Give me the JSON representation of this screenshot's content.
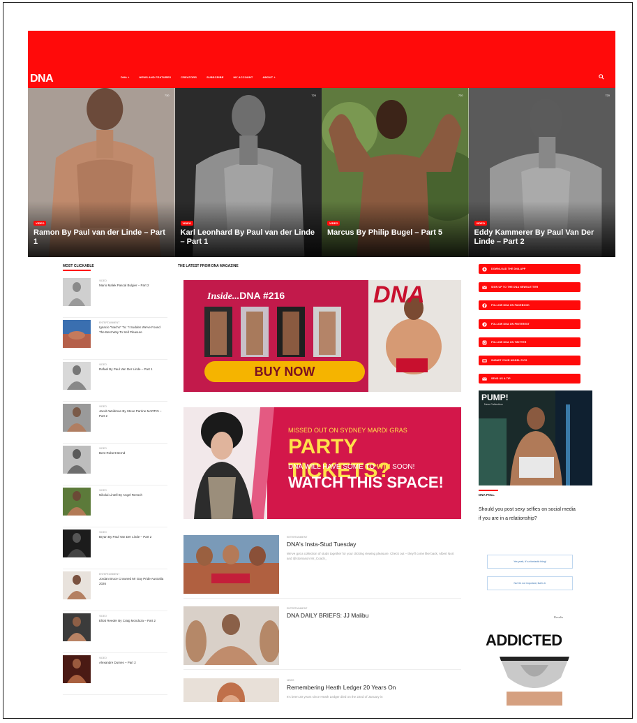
{
  "brand": {
    "logo": "DNA",
    "accent": "#ff0a0a"
  },
  "nav": [
    "DNA +",
    "NEWS AND FEATURES",
    "CREATORS",
    "SUBSCRIBE",
    "MY ACCOUNT",
    "ABOUT +"
  ],
  "hero": [
    {
      "tag": "VIDEO",
      "title": "Ramon By Paul van der Linde – Part 1",
      "views": "730"
    },
    {
      "tag": "VIDEO",
      "title": "Karl Leonhard By Paul van der Linde – Part 1",
      "views": "720"
    },
    {
      "tag": "VIDEO",
      "title": "Marcus By Philip Bugel – Part 5",
      "views": "720"
    },
    {
      "tag": "VIDEO",
      "title": "Eddy Kammerer By Paul Van Der Linde – Part 2",
      "views": "720"
    }
  ],
  "most_clickable": {
    "heading": "MOST CLICKABLE",
    "items": [
      {
        "kicker": "VIDEO",
        "title": "Mario Malek Pascal Bulgier – Part 2"
      },
      {
        "kicker": "ENTERTAINMENT",
        "title": "Ignacio \"Nacho\" Tu: \"I Sudden We've Found The Best Way To Sell Pleasure"
      },
      {
        "kicker": "VIDEO",
        "title": "Rafael By Paul Van Der Linde – Part 1"
      },
      {
        "kicker": "VIDEO",
        "title": "Jacob Weidman By Steve Parrine MARTIN – Part 2"
      },
      {
        "kicker": "VIDEO",
        "title": "Bent Robert Bernd"
      },
      {
        "kicker": "VIDEO",
        "title": "Nikolai Lintell By Angel Rensch"
      },
      {
        "kicker": "VIDEO",
        "title": "Bryan By Paul Van Der Linde – Part 2"
      },
      {
        "kicker": "ENTERTAINMENT",
        "title": "Jordan Bruce Crowned Mr Gay Pride Australia 2026"
      },
      {
        "kicker": "VIDEO",
        "title": "Eliott Reeder By Craig Mcndoza – Part 2"
      },
      {
        "kicker": "VIDEO",
        "title": "Alexandre Dumes – Part 2"
      }
    ]
  },
  "latest": {
    "heading": "THE LATEST FROM DNA MAGAZINE",
    "ad1": {
      "inside": "Inside...",
      "issue": "DNA #216",
      "cta": "BUY NOW",
      "cover_logo": "DNA"
    },
    "ad2": {
      "line1": "MISSED OUT ON SYDNEY MARDI GRAS",
      "line2": "PARTY TICKETS?",
      "line3a": "DNA WILL HAVE SOME TO ",
      "line3b": "WIN",
      "line3c": " SOON!",
      "line4": "WATCH THIS SPACE!"
    },
    "articles": [
      {
        "kicker": "ENTERTAINMENT",
        "title": "DNA's Insta-Stud Tuesday",
        "excerpt": "We've got a collection of studs together for your clicking viewing pleasure. Check out – they'll come like back, Albert Nort and @stomason Mr_Coach_"
      },
      {
        "kicker": "ENTERTAINMENT",
        "title": "DNA DAILY BRIEFS: JJ Malibu",
        "excerpt": ""
      },
      {
        "kicker": "NEWS",
        "title": "Remembering Heath Ledger 20 Years On",
        "excerpt": "It's been 20 years since Heath Ledger died on the 22nd of January in"
      }
    ]
  },
  "sidebar": {
    "buttons": [
      {
        "icon": "download-icon",
        "label": "DOWNLOAD THE DNA APP"
      },
      {
        "icon": "mail-icon",
        "label": "SIGN UP TO THE DNA NEWSLETTER"
      },
      {
        "icon": "facebook-icon",
        "label": "FOLLOW DNA ON FACEBOOK"
      },
      {
        "icon": "pinterest-icon",
        "label": "FOLLOW DNA ON PINTEREST"
      },
      {
        "icon": "instagram-icon",
        "label": "FOLLOW DNA ON TWITTER"
      },
      {
        "icon": "shop-icon",
        "label": "SUBMIT YOUR MODEL PICS"
      },
      {
        "icon": "mail-icon",
        "label": "SEND US A TIP"
      }
    ],
    "pump": {
      "brand": "PUMP!",
      "sub": "New Collection"
    },
    "poll": {
      "heading": "DNA POLL",
      "question": "Should you post sexy selfies on social media if you are in a relationship?",
      "options": [
        "Yes yeah, it's a fantastic thing!",
        "No! It's not important, that's it."
      ],
      "results": "Results"
    },
    "addicted": "ADDICTED"
  }
}
